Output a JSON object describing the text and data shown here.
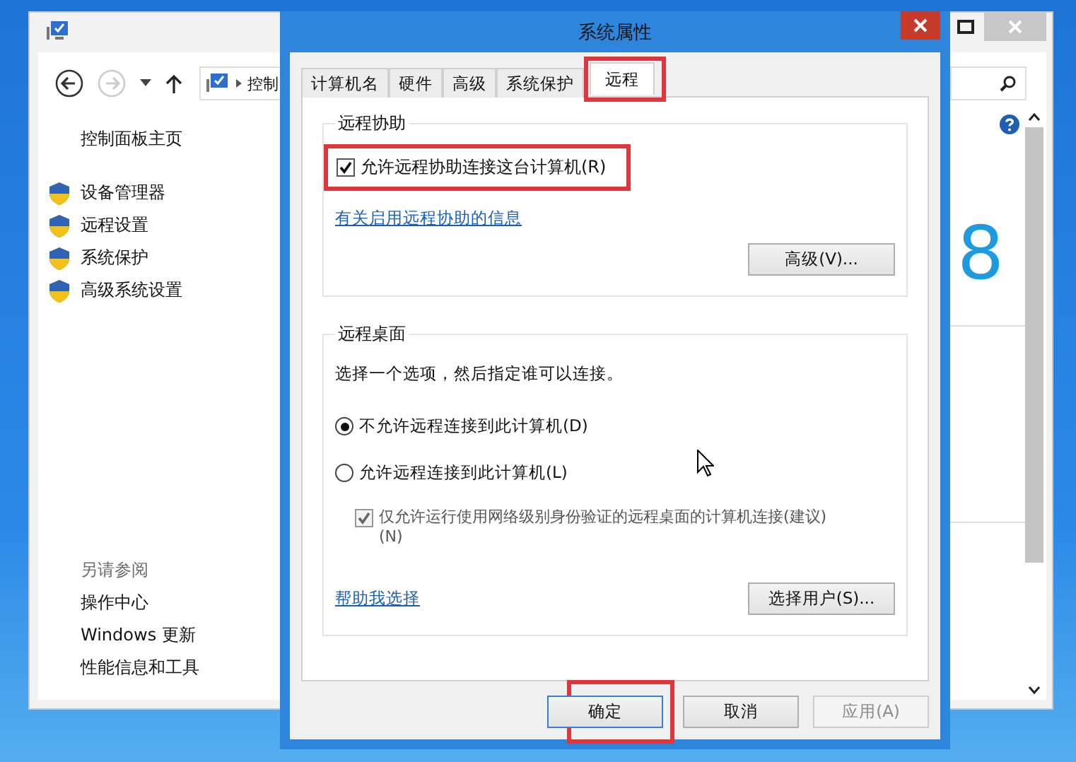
{
  "background_window": {
    "address": "控制",
    "home_link": "控制面板主页",
    "tasks": [
      "设备管理器",
      "远程设置",
      "系统保护",
      "高级系统设置"
    ],
    "see_also": {
      "heading": "另请参阅",
      "links": [
        "操作中心",
        "Windows 更新",
        "性能信息和工具"
      ]
    },
    "logo_fragment": "8"
  },
  "dialog": {
    "title": "系统属性",
    "tabs": [
      {
        "label": "计算机名",
        "selected": false,
        "highlighted": false
      },
      {
        "label": "硬件",
        "selected": false,
        "highlighted": false
      },
      {
        "label": "高级",
        "selected": false,
        "highlighted": false
      },
      {
        "label": "系统保护",
        "selected": false,
        "highlighted": false
      },
      {
        "label": "远程",
        "selected": true,
        "highlighted": true
      }
    ],
    "remote_assistance": {
      "heading": "远程协助",
      "allow": {
        "label": "允许远程协助连接这台计算机(R)",
        "checked": true,
        "highlighted": true
      },
      "info_link": "有关启用远程协助的信息",
      "advanced_button": "高级(V)..."
    },
    "remote_desktop": {
      "heading": "远程桌面",
      "instruction": "选择一个选项，然后指定谁可以连接。",
      "options": [
        {
          "label": "不允许远程连接到此计算机(D)",
          "selected": true
        },
        {
          "label": "允许远程连接到此计算机(L)",
          "selected": false
        }
      ],
      "nla": {
        "label": "仅允许运行使用网络级别身份验证的远程桌面的计算机连接(建议)",
        "suffix": "(N)",
        "checked": true,
        "disabled": true
      },
      "help_link": "帮助我选择",
      "select_users_button": "选择用户(S)..."
    },
    "buttons": [
      {
        "label": "确定",
        "disabled": false,
        "highlighted": true
      },
      {
        "label": "取消",
        "disabled": false,
        "highlighted": false
      },
      {
        "label": "应用(A)",
        "disabled": true,
        "highlighted": false
      }
    ]
  }
}
